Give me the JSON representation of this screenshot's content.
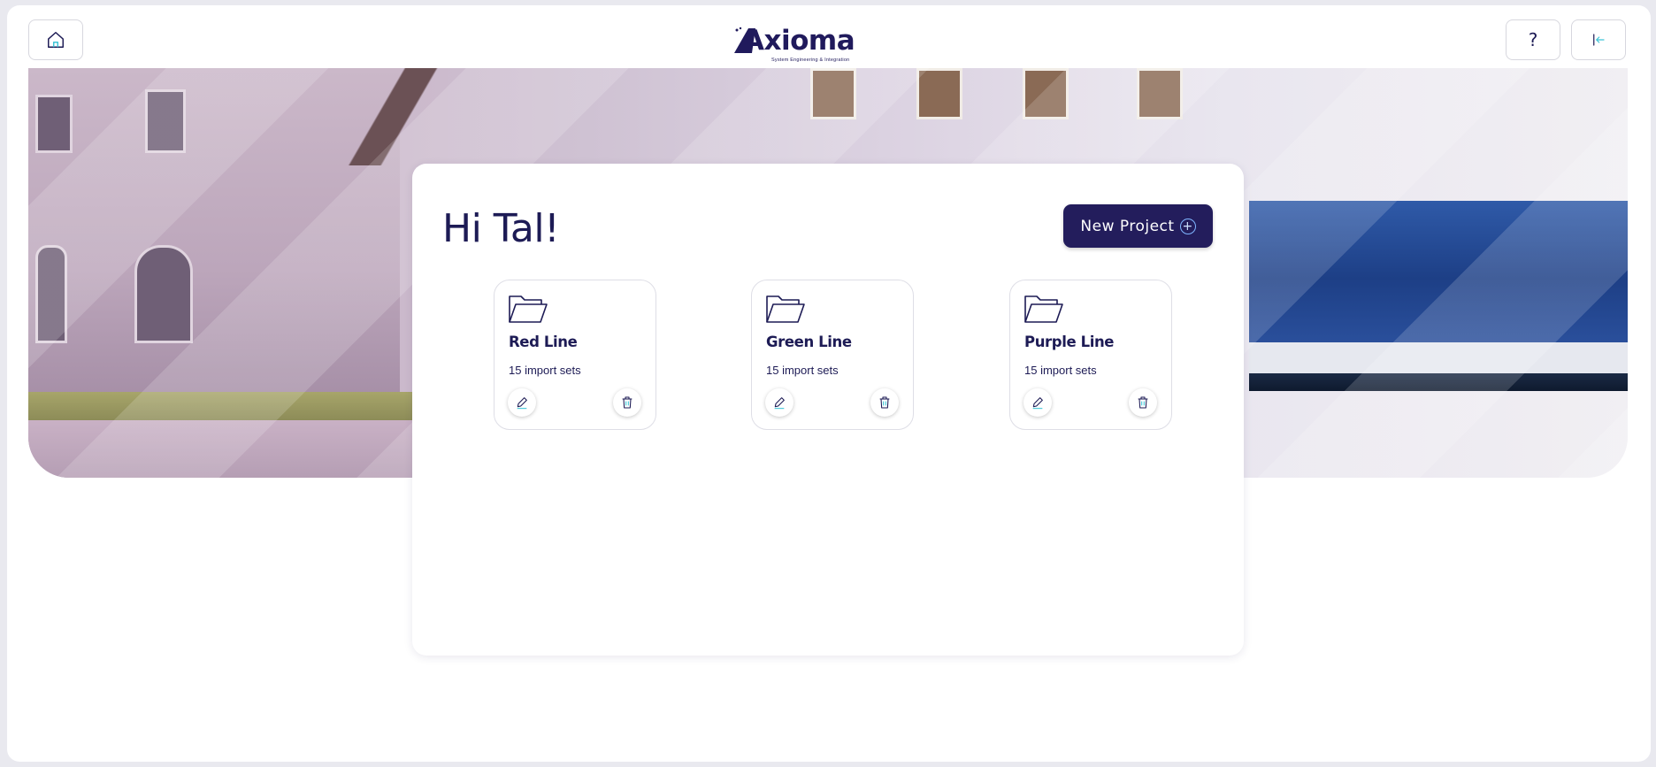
{
  "header": {
    "home_icon": "home-icon",
    "help_label": "?",
    "logout_icon": "logout-icon",
    "logo": {
      "name": "Axioma",
      "tagline": "System Engineering & Integration"
    }
  },
  "main": {
    "greeting": "Hi Tal!",
    "new_project_label": "New Project",
    "new_project_icon": "plus-circle-icon",
    "projects": [
      {
        "name": "Red Line",
        "count": "15 import sets"
      },
      {
        "name": "Green Line",
        "count": "15 import sets"
      },
      {
        "name": "Purple Line",
        "count": "15 import sets"
      }
    ]
  },
  "colors": {
    "brand_navy": "#231d5c",
    "text_dark": "#1d1b55",
    "accent_blue": "#7fb5ff",
    "icon_teal": "#3cc4d6"
  }
}
